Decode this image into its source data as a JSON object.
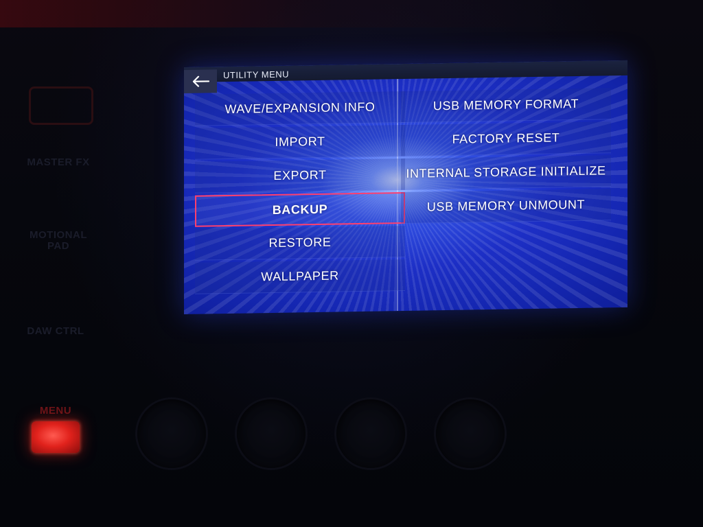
{
  "hardware": {
    "labels": {
      "master_fx": "MASTER FX",
      "motional_pad_line1": "MOTIONAL",
      "motional_pad_line2": "PAD",
      "daw_ctrl": "DAW CTRL",
      "menu": "MENU"
    },
    "menu_button_color": "#e1221c"
  },
  "screen": {
    "title": "UTILITY MENU",
    "back_icon": "arrow-left-icon",
    "left_items": [
      {
        "label": "WAVE/EXPANSION INFO"
      },
      {
        "label": "IMPORT"
      },
      {
        "label": "EXPORT"
      },
      {
        "label": "BACKUP",
        "selected": true
      },
      {
        "label": "RESTORE"
      },
      {
        "label": "WALLPAPER"
      }
    ],
    "right_items": [
      {
        "label": "USB MEMORY FORMAT"
      },
      {
        "label": "FACTORY RESET"
      },
      {
        "label": "INTERNAL STORAGE INITIALIZE"
      },
      {
        "label": "USB MEMORY UNMOUNT"
      }
    ],
    "colors": {
      "selection_border": "#ff3f6e",
      "background_blue": "#1d2fc6"
    }
  }
}
